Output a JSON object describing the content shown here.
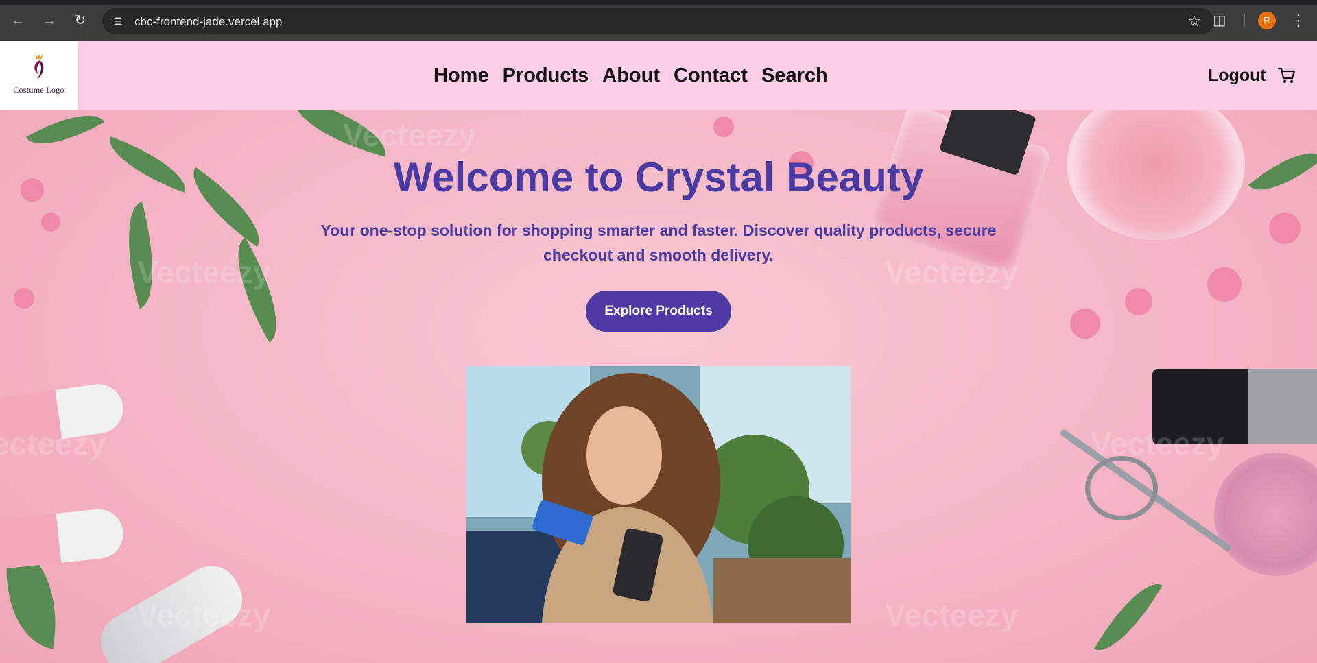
{
  "browser": {
    "url": "cbc-frontend-jade.vercel.app",
    "profile_initial": "R",
    "icons": {
      "back": "arrow-left-icon",
      "forward": "arrow-right-icon",
      "reload": "reload-icon",
      "site_info": "tune-icon",
      "bookmark": "star-icon",
      "extensions": "puzzle-icon",
      "menu": "kebab-icon"
    }
  },
  "header": {
    "logo_text": "Costume Logo",
    "nav": [
      "Home",
      "Products",
      "About",
      "Contact",
      "Search"
    ],
    "logout": "Logout",
    "cart_icon": "cart-icon",
    "background": "#fbcde6"
  },
  "hero": {
    "title": "Welcome to Crystal Beauty",
    "subtitle": "Your one-stop solution for shopping smarter and faster. Discover quality products, secure checkout and smooth delivery.",
    "cta": "Explore Products",
    "text_color": "#4a3aa2",
    "button_color": "#4e3aa4",
    "watermark": "Vecteezy"
  }
}
